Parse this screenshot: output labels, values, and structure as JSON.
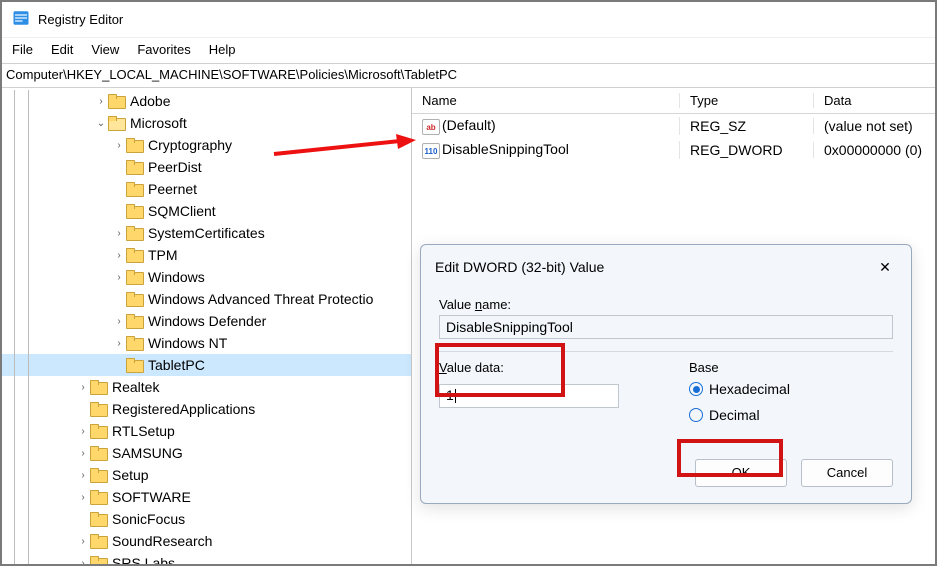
{
  "window": {
    "title": "Registry Editor"
  },
  "menubar": {
    "file": "File",
    "edit": "Edit",
    "view": "View",
    "favorites": "Favorites",
    "help": "Help"
  },
  "addressbar": {
    "path": "Computer\\HKEY_LOCAL_MACHINE\\SOFTWARE\\Policies\\Microsoft\\TabletPC"
  },
  "tree": {
    "items": [
      {
        "label": "Adobe",
        "indent": 3,
        "tw": "right",
        "open": false
      },
      {
        "label": "Microsoft",
        "indent": 3,
        "tw": "down",
        "open": true
      },
      {
        "label": "Cryptography",
        "indent": 4,
        "tw": "right",
        "open": false
      },
      {
        "label": "PeerDist",
        "indent": 4,
        "tw": "",
        "open": false
      },
      {
        "label": "Peernet",
        "indent": 4,
        "tw": "",
        "open": false
      },
      {
        "label": "SQMClient",
        "indent": 4,
        "tw": "",
        "open": false
      },
      {
        "label": "SystemCertificates",
        "indent": 4,
        "tw": "right",
        "open": false
      },
      {
        "label": "TPM",
        "indent": 4,
        "tw": "right",
        "open": false
      },
      {
        "label": "Windows",
        "indent": 4,
        "tw": "right",
        "open": false
      },
      {
        "label": "Windows Advanced Threat Protectio",
        "indent": 4,
        "tw": "",
        "open": false
      },
      {
        "label": "Windows Defender",
        "indent": 4,
        "tw": "right",
        "open": false
      },
      {
        "label": "Windows NT",
        "indent": 4,
        "tw": "right",
        "open": false
      },
      {
        "label": "TabletPC",
        "indent": 4,
        "tw": "",
        "open": false,
        "selected": true
      },
      {
        "label": "Realtek",
        "indent": 2,
        "tw": "right",
        "open": false
      },
      {
        "label": "RegisteredApplications",
        "indent": 2,
        "tw": "",
        "open": false
      },
      {
        "label": "RTLSetup",
        "indent": 2,
        "tw": "right",
        "open": false
      },
      {
        "label": "SAMSUNG",
        "indent": 2,
        "tw": "right",
        "open": false
      },
      {
        "label": "Setup",
        "indent": 2,
        "tw": "right",
        "open": false
      },
      {
        "label": "SOFTWARE",
        "indent": 2,
        "tw": "right",
        "open": false
      },
      {
        "label": "SonicFocus",
        "indent": 2,
        "tw": "",
        "open": false
      },
      {
        "label": "SoundResearch",
        "indent": 2,
        "tw": "right",
        "open": false
      },
      {
        "label": "SRS Labs",
        "indent": 2,
        "tw": "right",
        "open": false
      }
    ]
  },
  "list": {
    "headers": {
      "name": "Name",
      "type": "Type",
      "data": "Data"
    },
    "rows": [
      {
        "icon": "sz",
        "name": "(Default)",
        "type": "REG_SZ",
        "data": "(value not set)"
      },
      {
        "icon": "dw",
        "name": "DisableSnippingTool",
        "type": "REG_DWORD",
        "data": "0x00000000 (0)"
      }
    ]
  },
  "dialog": {
    "title": "Edit DWORD (32-bit) Value",
    "value_name_label": "Value name:",
    "value_name": "DisableSnippingTool",
    "value_data_label": "Value data:",
    "value_data": "1",
    "base_label": "Base",
    "hex_label": "Hexadecimal",
    "dec_label": "Decimal",
    "ok_label": "OK",
    "cancel_label": "Cancel"
  }
}
